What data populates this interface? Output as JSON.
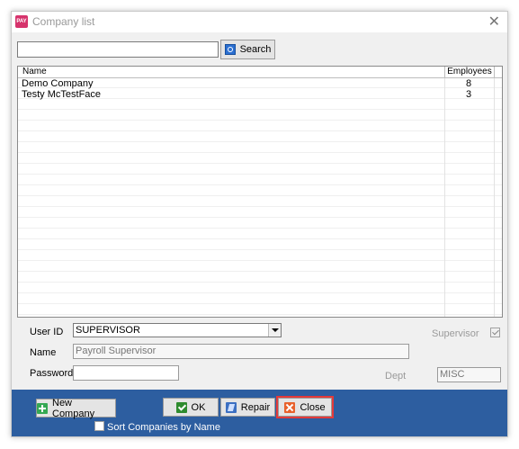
{
  "window": {
    "title": "Company list",
    "app_icon_text": "PAY"
  },
  "search": {
    "value": "",
    "button_label": "Search"
  },
  "table": {
    "columns": {
      "name": "Name",
      "employees": "Employees"
    },
    "rows": [
      {
        "name": "Demo Company",
        "employees": "8"
      },
      {
        "name": "Testy McTestFace",
        "employees": "3"
      }
    ]
  },
  "form": {
    "user_id_label": "User ID",
    "user_id_value": "SUPERVISOR",
    "supervisor_label": "Supervisor",
    "supervisor_checked": true,
    "name_label": "Name",
    "name_value": "Payroll Supervisor",
    "password_label": "Password",
    "password_value": "",
    "dept_label": "Dept",
    "dept_value": "MISC"
  },
  "buttons": {
    "new_company": "New Company",
    "ok": "OK",
    "repair": "Repair",
    "close": "Close"
  },
  "sort_checkbox": {
    "label": "Sort Companies by Name",
    "checked": false
  },
  "colors": {
    "bottom_bar": "#2d5ea0",
    "highlight": "#e33a3a",
    "app_icon": "#d6336c"
  },
  "icons": {
    "app": "pay-app-icon",
    "window_close": "close-icon",
    "search": "search-icon",
    "new_company": "plus-icon",
    "ok": "checkmark-icon",
    "repair": "repair-icon",
    "close": "close-x-icon",
    "dropdown": "chevron-down-icon"
  }
}
